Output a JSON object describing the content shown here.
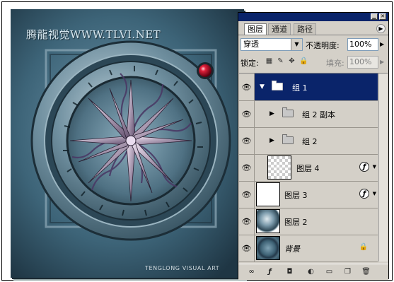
{
  "watermark": {
    "top": "腾龍视觉WWW.TLVI.NET",
    "bottom": "TENGLONG VISUAL ART"
  },
  "panel": {
    "title_buttons": [
      "minimize",
      "close"
    ],
    "tabs": [
      {
        "label": "图层",
        "active": true
      },
      {
        "label": "通道",
        "active": false
      },
      {
        "label": "路径",
        "active": false
      }
    ],
    "blend_mode": "穿透",
    "opacity_label": "不透明度:",
    "opacity_value": "100%",
    "lock_label": "锁定:",
    "fill_label": "填充:",
    "fill_value": "100%",
    "layers": [
      {
        "name": "组 1",
        "type": "group",
        "expanded": true,
        "selected": true
      },
      {
        "name": "组 2 副本",
        "type": "group",
        "expanded": false,
        "selected": false
      },
      {
        "name": "组 2",
        "type": "group",
        "expanded": false,
        "selected": false
      },
      {
        "name": "图层 4",
        "type": "layer",
        "thumb": "transparent",
        "fx": true
      },
      {
        "name": "图层 3",
        "type": "layer",
        "thumb": "white",
        "fx": true
      },
      {
        "name": "图层 2",
        "type": "layer",
        "thumb": "orb"
      },
      {
        "name": "背景",
        "type": "background",
        "thumb": "background",
        "locked": true
      }
    ],
    "bottom_icons": [
      "link-icon",
      "fx-icon",
      "mask-icon",
      "adjustment-icon",
      "new-group-icon",
      "new-layer-icon",
      "trash-icon"
    ],
    "colors": {
      "selection": "#0a246a",
      "panel_bg": "#d4d0c8",
      "canvas_bg": "#2a4a5c"
    }
  }
}
